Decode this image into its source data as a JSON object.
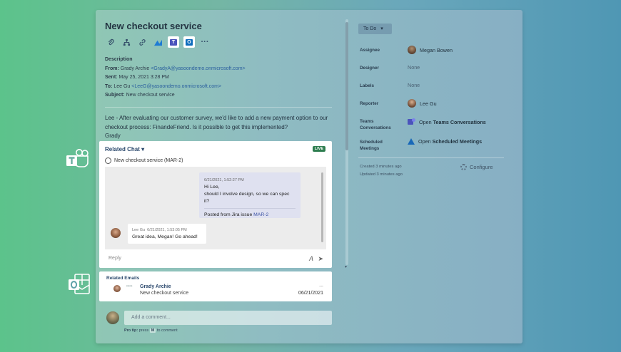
{
  "issue": {
    "title": "New checkout service",
    "toolbar_icons": [
      "paperclip-icon",
      "hierarchy-icon",
      "link-icon",
      "jira-align-icon",
      "teams-icon",
      "outlook-icon",
      "more-icon"
    ]
  },
  "email": {
    "description_label": "Description",
    "from_label": "From:",
    "from_name": "Grady Archie",
    "from_address": "<GradyA@yasoondemo.onmicrosoft.com>",
    "sent_label": "Sent:",
    "sent_value": "May 25, 2021 3:28 PM",
    "to_label": "To:",
    "to_name": "Lee Gu",
    "to_address": "<LeeG@yasoondemo.onmicrosoft.com>",
    "subject_label": "Subject:",
    "subject_value": "New checkout service",
    "body": "Lee - After evaluating our customer survey, we'd like to add a new payment option to our checkout process: FinandeFriend. Is it possible to get this implemented?",
    "signature": "Grady"
  },
  "related_chat": {
    "header": "Related Chat",
    "live_badge": "LIVE",
    "chat_title": "New checkout service (MAR-2)",
    "message1": {
      "timestamp": "6/21/2021, 1:52:27 PM",
      "line1": "Hi Lee,",
      "line2": "should I involve design, so we can spec it?",
      "posted_prefix": "Posted from Jira issue",
      "posted_link": "MAR-2"
    },
    "message2": {
      "author": "Lee Gu",
      "timestamp": "6/21/2021, 1:53:05 PM",
      "text": "Great idea, Megan! Go ahead!"
    },
    "reply_placeholder": "Reply"
  },
  "related_emails": {
    "header": "Related Emails",
    "sender": "Grady Archie",
    "subject": "New checkout service",
    "date": "06/21/2021",
    "more": "..."
  },
  "comment": {
    "placeholder": "Add a comment...",
    "protip_bold": "Pro tip:",
    "protip_pre": "press",
    "protip_key": "M",
    "protip_post": "to comment"
  },
  "sidebar": {
    "status": "To Do",
    "assignee_label": "Assignee",
    "assignee_value": "Megan Bowen",
    "designer_label": "Designer",
    "designer_value": "None",
    "labels_label": "Labels",
    "labels_value": "None",
    "reporter_label": "Reporter",
    "reporter_value": "Lee Gu",
    "teams_label_1": "Teams",
    "teams_label_2": "Conversations",
    "teams_value_pre": "Open",
    "teams_value_bold": "Teams Conversations",
    "sched_label_1": "Scheduled",
    "sched_label_2": "Meetings",
    "sched_value_pre": "Open",
    "sched_value_bold": "Scheduled Meetings",
    "created": "Created 3 minutes ago",
    "updated": "Updated 3 minutes ago",
    "configure": "Configure"
  },
  "colors": {
    "teams": "#4b53bc",
    "outlook": "#0f6cbd",
    "live": "#2e7d4f",
    "link": "#3b52a4"
  }
}
